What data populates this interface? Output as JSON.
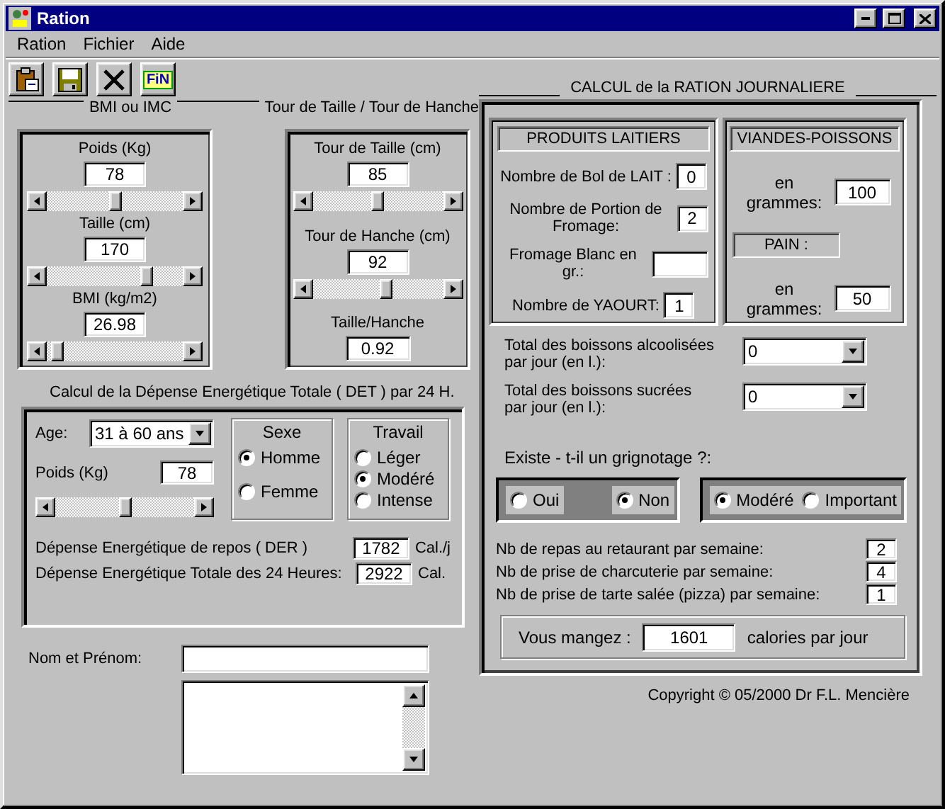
{
  "window": {
    "title": "Ration"
  },
  "menu": [
    {
      "label": "Ration"
    },
    {
      "label": "Fichier"
    },
    {
      "label": "Aide"
    }
  ],
  "toolbar": [
    {
      "kind": "clipboard"
    },
    {
      "kind": "save"
    },
    {
      "kind": "close"
    },
    {
      "kind": "fin",
      "label": "FiN"
    }
  ],
  "bmi": {
    "heading": "BMI ou IMC",
    "fields": [
      {
        "kind": "slider",
        "label": "Poids (Kg)",
        "value": "78",
        "level": 0.5
      },
      {
        "kind": "slider",
        "label": "Taille (cm)",
        "value": "170",
        "level": 0.76
      },
      {
        "kind": "slider",
        "label": "BMI (kg/m2)",
        "value": "26.98",
        "level": 0.04
      }
    ]
  },
  "waist": {
    "heading": "Tour de Taille / Tour de Hanche",
    "fields": [
      {
        "kind": "slider",
        "label": "Tour de Taille (cm)",
        "value": "85",
        "level": 0.5
      },
      {
        "kind": "slider",
        "label": "Tour de Hanche (cm)",
        "value": "92",
        "level": 0.57
      },
      {
        "kind": "output",
        "label": "Taille/Hanche",
        "value": "0.92"
      }
    ]
  },
  "det": {
    "heading": "Calcul de la Dépense Energétique Totale ( DET ) par 24 H.",
    "age": {
      "label": "Age:",
      "value": "31 à 60 ans"
    },
    "weight": {
      "label": "Poids (Kg)",
      "value": "78",
      "level": 0.5
    },
    "sexe": {
      "title": "Sexe",
      "options": [
        {
          "label": "Homme",
          "selected": true
        },
        {
          "label": "Femme",
          "selected": false
        }
      ]
    },
    "travail": {
      "title": "Travail",
      "options": [
        {
          "label": "Léger",
          "selected": false
        },
        {
          "label": "Modéré",
          "selected": true
        },
        {
          "label": "Intense",
          "selected": false
        }
      ]
    },
    "results": [
      {
        "label": "Dépense Energétique de repos ( DER )",
        "value": "1782",
        "unit": "Cal./j"
      },
      {
        "label": "Dépense Energétique Totale des 24 Heures:",
        "value": "2922",
        "unit": "Cal."
      }
    ]
  },
  "identity": {
    "label": "Nom et Prénom:"
  },
  "ration": {
    "heading": "CALCUL de la RATION JOURNALIERE",
    "dairy": {
      "title": "PRODUITS LAITIERS",
      "rows": [
        {
          "label": "Nombre de Bol de LAIT :",
          "value": "0"
        },
        {
          "label": "Nombre de Portion de Fromage:",
          "value": "2"
        },
        {
          "label": "Fromage Blanc en gr.:"
        },
        {
          "label": "Nombre de YAOURT:",
          "value": "1"
        }
      ]
    },
    "meat": {
      "title": "VIANDES-POISSONS",
      "label": "en grammes:",
      "value": "100"
    },
    "bread": {
      "title": "PAIN :",
      "label": "en grammes:",
      "value": "50"
    },
    "drinks": [
      {
        "label": "Total des boissons alcoolisées par jour (en l.):",
        "value": "0"
      },
      {
        "label": "Total des boissons sucrées par jour (en l.):",
        "value": "0"
      }
    ],
    "snacking": {
      "question": "Existe - t-il un grignotage ?:",
      "answer": [
        {
          "label": "Oui",
          "selected": false
        },
        {
          "label": "Non",
          "selected": true
        }
      ],
      "amount": [
        {
          "label": "Modéré",
          "selected": true
        },
        {
          "label": "Important",
          "selected": false
        }
      ]
    },
    "weekly": [
      {
        "label": "Nb de repas au retaurant par semaine:",
        "value": "2"
      },
      {
        "label": "Nb de prise de charcuterie par semaine:",
        "value": "4"
      },
      {
        "label": "Nb de prise de tarte salée (pizza) par semaine:",
        "value": "1"
      }
    ],
    "total": {
      "label": "Vous mangez :",
      "value": "1601",
      "unit": "calories par jour"
    }
  },
  "copyright": "Copyright © 05/2000 Dr F.L. Mencière"
}
